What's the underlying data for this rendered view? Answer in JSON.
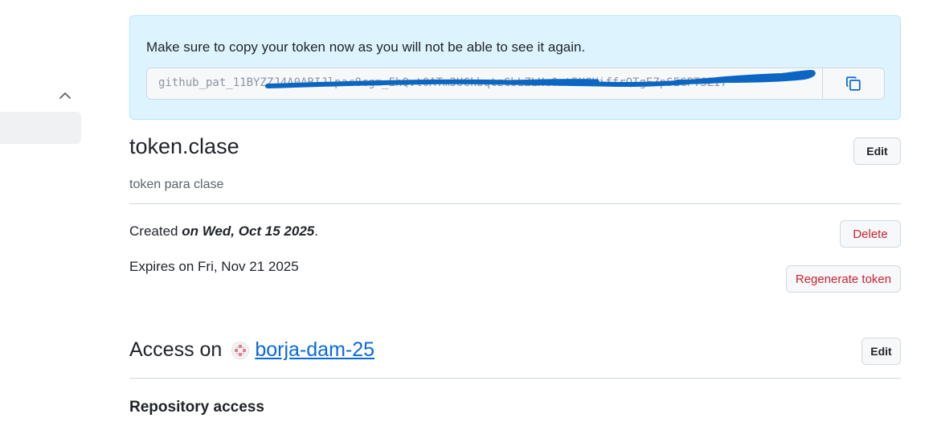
{
  "sidebar": {
    "collapse_icon": "chevron-up-icon"
  },
  "flash": {
    "message": "Make sure to copy your token now as you will not be able to see it again.",
    "token_value": "github_pat_11BYZZJ4A0ABIJlpac8cgm_EhQvt0ATm3UCkbqtzGbLZLHc0mt5XGHiffrQTgEZpSEGPTSZI7",
    "copy_icon": "copy-icon",
    "background_color": "#ddf4ff",
    "redaction_color": "#0a66c2"
  },
  "token": {
    "name": "token.clase",
    "description": "token para clase",
    "edit_label": "Edit",
    "created_prefix": "Created ",
    "created_date": "on Wed, Oct 15 2025",
    "created_suffix": ".",
    "expires_text": "Expires on Fri, Nov 21 2025",
    "delete_label": "Delete",
    "regenerate_label": "Regenerate token"
  },
  "access": {
    "heading": "Access on",
    "org_name": "borja-dam-25",
    "org_avatar_icon": "org-identicon-icon",
    "edit_label": "Edit",
    "repository_access_heading": "Repository access"
  },
  "colors": {
    "accent": "#0969da",
    "danger": "#cf222e",
    "border": "#d1d9e0"
  }
}
